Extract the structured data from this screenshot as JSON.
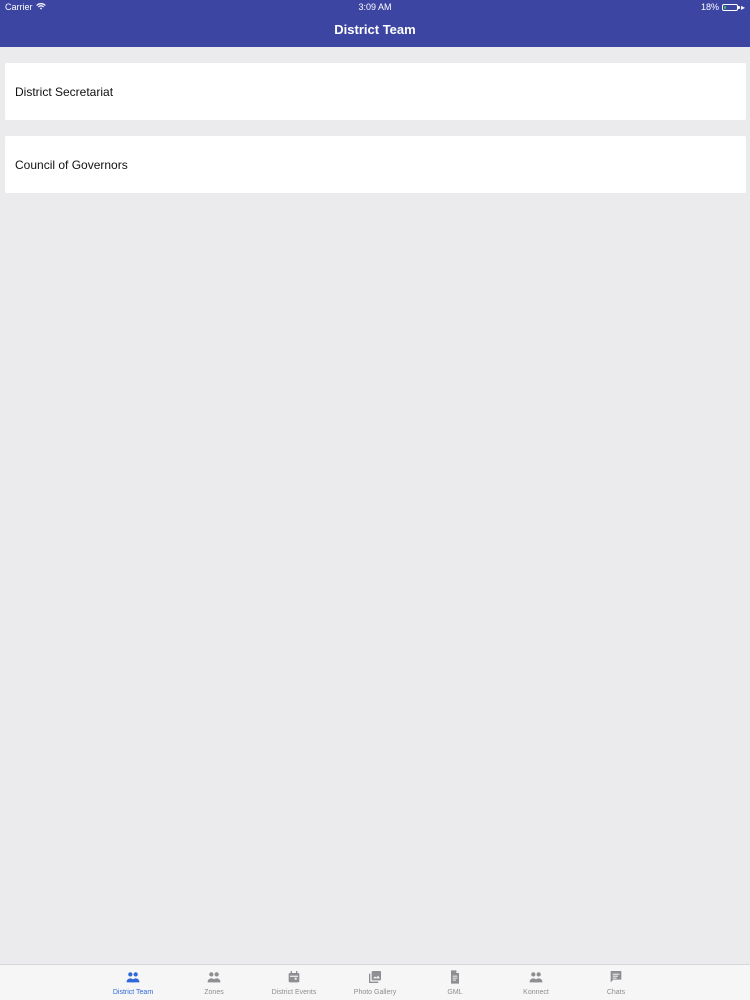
{
  "status_bar": {
    "carrier": "Carrier",
    "time": "3:09 AM",
    "battery": "18%",
    "battery_level": 0.18,
    "wifi_icon": "wifi-icon",
    "battery_icon": "battery-icon",
    "charging_icon": "charging-icon"
  },
  "header": {
    "title": "District Team",
    "background": "#3d45a3"
  },
  "list": {
    "items": [
      {
        "label": "District Secretariat"
      },
      {
        "label": "Council of Governors"
      }
    ]
  },
  "tab_bar": {
    "active_color": "#2f68d8",
    "inactive_color": "#8e8e93",
    "items": [
      {
        "label": "District Team",
        "icon": "people-icon",
        "active": true
      },
      {
        "label": "Zones",
        "icon": "people-icon",
        "active": false
      },
      {
        "label": "District Events",
        "icon": "calendar-icon",
        "active": false
      },
      {
        "label": "Photo Gallery",
        "icon": "photo-library-icon",
        "active": false
      },
      {
        "label": "GML",
        "icon": "document-icon",
        "active": false
      },
      {
        "label": "Konnect",
        "icon": "people-icon",
        "active": false
      },
      {
        "label": "Chats",
        "icon": "chat-icon",
        "active": false
      }
    ]
  }
}
